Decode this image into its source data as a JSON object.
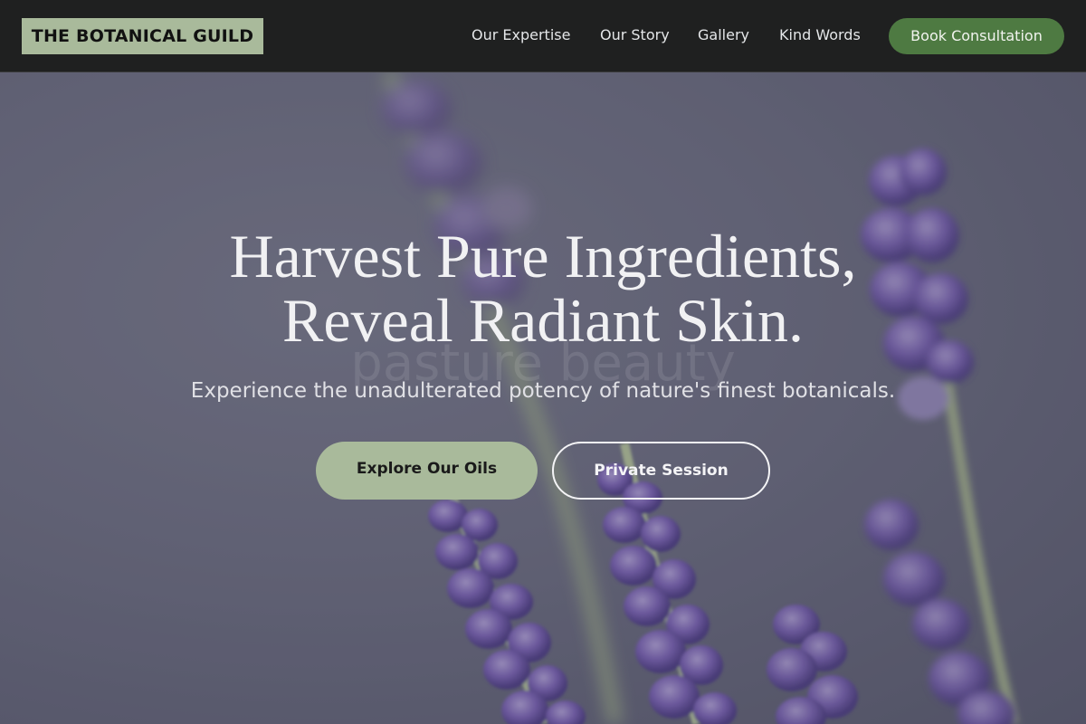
{
  "header": {
    "logo": "THE BOTANICAL GUILD",
    "nav": [
      {
        "label": "Our Expertise"
      },
      {
        "label": "Our Story"
      },
      {
        "label": "Gallery"
      },
      {
        "label": "Kind Words"
      }
    ],
    "cta_label": "Book Consultation"
  },
  "hero": {
    "headline_line1": "Harvest Pure Ingredients,",
    "headline_line2": "Reveal Radiant Skin.",
    "background_text": "pasture beauty",
    "subheadline": "Experience the unadulterated potency of nature's finest botanicals.",
    "primary_button": "Explore Our Oils",
    "secondary_button": "Private Session",
    "background_image": "lavender-flowers"
  },
  "colors": {
    "header_bg": "#1f2020",
    "logo_bg": "#a9ba9b",
    "accent_green": "#4e7a42",
    "sage": "#a9ba9b",
    "hero_bg": "#6c6d82",
    "lavender": "#7a62b8"
  }
}
